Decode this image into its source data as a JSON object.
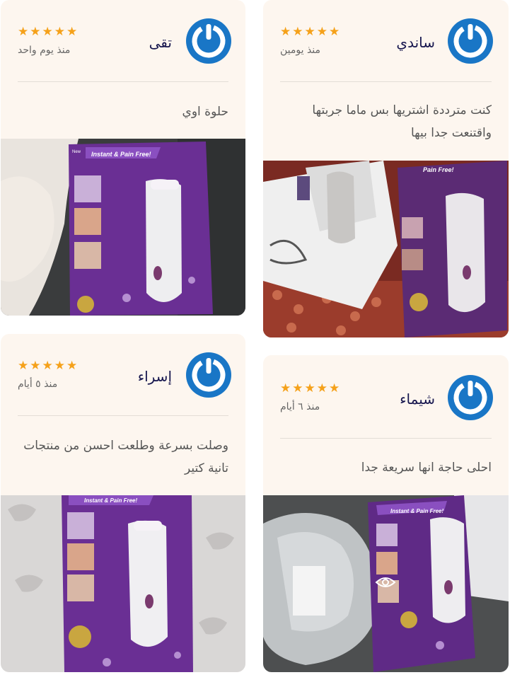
{
  "reviews": [
    {
      "name": "تقى",
      "time": "منذ يوم واحد",
      "rating": 5,
      "text": "حلوة اوي"
    },
    {
      "name": "ساندي",
      "time": "منذ يومين",
      "rating": 5,
      "text": "كنت مترددة اشتريها بس ماما جربتها واقتنعت جدا بيها"
    },
    {
      "name": "إسراء",
      "time": "منذ ٥ أيام",
      "rating": 5,
      "text": "وصلت بسرعة وطلعت احسن من منتجات تانية كتير"
    },
    {
      "name": "شيماء",
      "time": "منذ ٦ أيام",
      "rating": 5,
      "text": "احلى حاجة انها سريعة جدا"
    }
  ],
  "product_box": {
    "headline": "Instant & Pain Free!",
    "brand_tag": "New"
  },
  "colors": {
    "avatar": "#1976c6",
    "star": "#f5a11a",
    "name": "#16164e",
    "card": "#fdf6ef",
    "box": "#6a2f94"
  }
}
